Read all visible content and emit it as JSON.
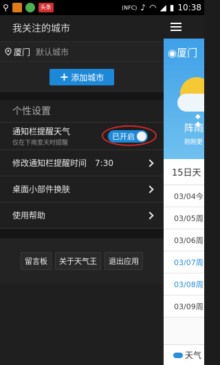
{
  "status_bar": {
    "time": "10:38",
    "nfc": "(NFC)",
    "app_badge": "头条"
  },
  "drawer": {
    "title": "我关注的城市",
    "city": {
      "name": "厦门",
      "default_label": "默认城市"
    },
    "add_city_label": "添加城市",
    "settings_title": "个性设置",
    "notify": {
      "title": "通知栏提醒天气",
      "subtitle": "仅在下雨变天时提醒",
      "toggle_label": "已开启"
    },
    "notify_time": {
      "label": "修改通知栏提醒时间",
      "value": "7:30"
    },
    "widget_skin_label": "桌面小部件换肤",
    "help_label": "使用帮助",
    "buttons": {
      "message_board": "留言板",
      "about": "关于天气王",
      "exit": "退出应用"
    }
  },
  "main": {
    "city": "厦门",
    "condition": "阵雨",
    "updated": "刚刚更",
    "forecast_header": "15日天",
    "days": [
      "03/04今",
      "03/05周",
      "03/06周",
      "03/07周",
      "03/08周",
      "03/09周"
    ],
    "bottom_label": "天气"
  },
  "colors": {
    "accent": "#1e88d8",
    "highlight": "#d02828"
  }
}
